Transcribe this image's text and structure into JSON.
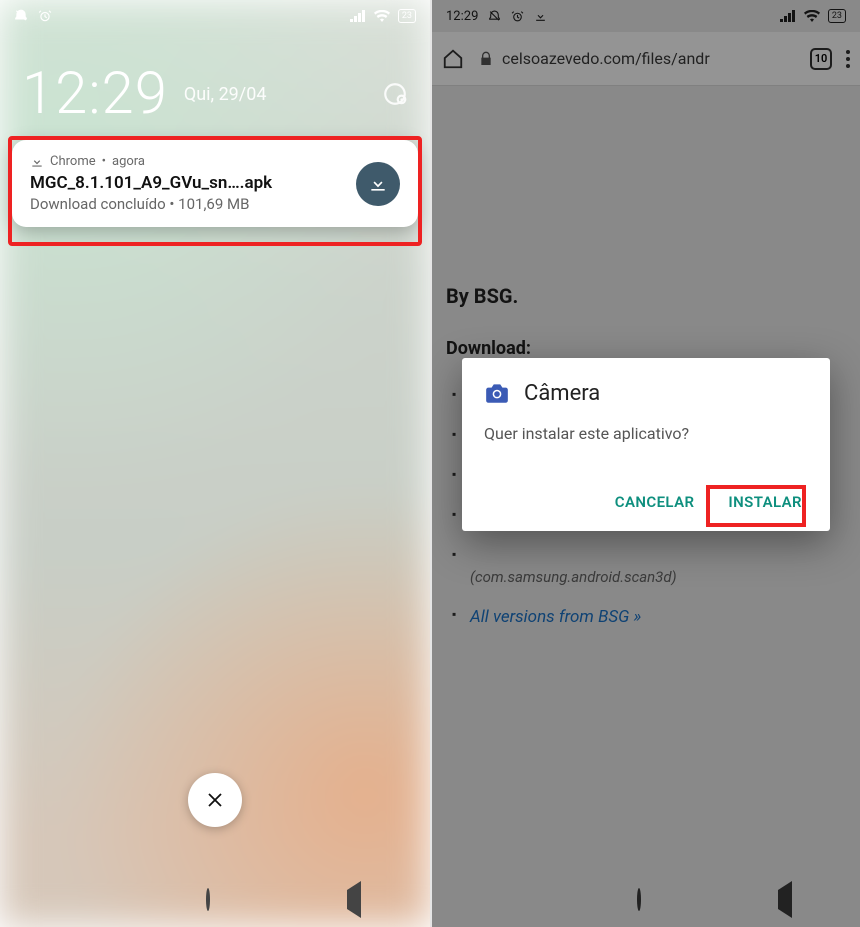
{
  "left": {
    "statusbar": {
      "battery": "23"
    },
    "clock": "12:29",
    "date": "Qui, 29/04",
    "notification": {
      "app": "Chrome",
      "when": "agora",
      "title": "MGC_8.1.101_A9_GVu_sn….apk",
      "subtitle": "Download concluído • 101,69 MB"
    }
  },
  "right": {
    "statusbar": {
      "time": "12:29",
      "battery": "23"
    },
    "browser": {
      "url": "celsoazevedo.com/files/andr",
      "tab_count": "10"
    },
    "page": {
      "by": "By BSG.",
      "download_heading": "Download:",
      "pkg": "(com.samsung.android.scan3d)",
      "all_versions": "All versions from BSG »"
    },
    "dialog": {
      "app_name": "Câmera",
      "message": "Quer instalar este aplicativo?",
      "cancel": "CANCELAR",
      "install": "INSTALAR"
    }
  }
}
